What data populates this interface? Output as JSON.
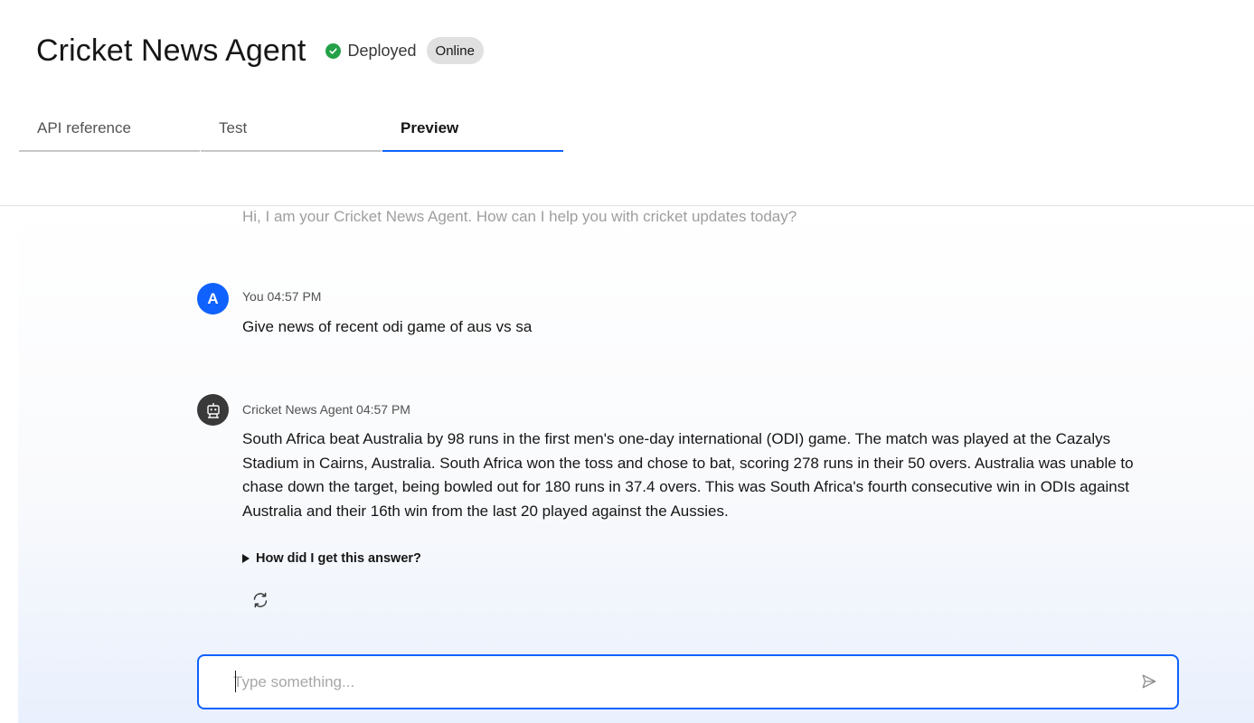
{
  "header": {
    "title": "Cricket News Agent",
    "status_label": "Deployed",
    "badge": "Online",
    "status_color": "#24a148"
  },
  "tabs": [
    {
      "label": "API reference",
      "active": false
    },
    {
      "label": "Test",
      "active": false
    },
    {
      "label": "Preview",
      "active": true
    }
  ],
  "chat": {
    "greeting": "Hi, I am your Cricket News Agent. How can I help you with cricket updates today?",
    "messages": [
      {
        "avatar": "A",
        "sender": "You",
        "time": "04:57 PM",
        "meta": "You 04:57 PM",
        "text": "Give news of recent odi game of aus vs sa"
      },
      {
        "avatar_icon": "robot-icon",
        "sender": "Cricket News Agent",
        "time": "04:57 PM",
        "meta": "Cricket News Agent 04:57 PM",
        "text": "South Africa beat Australia by 98 runs in the first men's one-day international (ODI) game. The match was played at the Cazalys Stadium in Cairns, Australia. South Africa won the toss and chose to bat, scoring 278 runs in their 50 overs. Australia was unable to chase down the target, being bowled out for 180 runs in 37.4 overs. This was South Africa's fourth consecutive win in ODIs against Australia and their 16th win from the last 20 played against the Aussies."
      }
    ],
    "details_label": "How did I get this answer?",
    "regenerate_icon": "refresh-icon"
  },
  "input": {
    "placeholder": "Type something...",
    "value": "",
    "send_icon": "send-icon"
  },
  "colors": {
    "accent": "#0f62fe",
    "bot_avatar": "#393939"
  }
}
